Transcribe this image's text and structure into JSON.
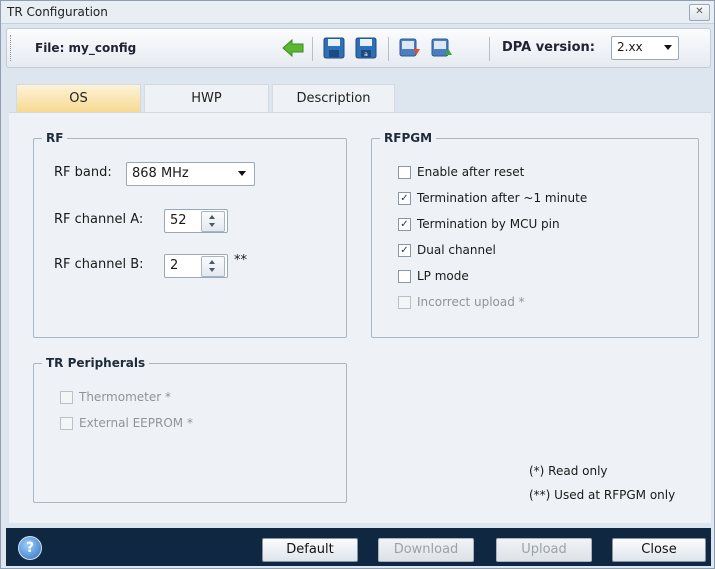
{
  "window": {
    "title": "TR Configuration",
    "close_glyph": "✕"
  },
  "toolbar": {
    "file_label": "File: my_config",
    "icons": [
      "back-arrow-icon",
      "save-icon",
      "save-as-icon",
      "download-icon",
      "upload-icon"
    ],
    "dpa_label": "DPA version:",
    "dpa_value": "2.xx"
  },
  "tabs": [
    {
      "label": "OS",
      "active": true
    },
    {
      "label": "HWP",
      "active": false
    },
    {
      "label": "Description",
      "active": false
    }
  ],
  "rf": {
    "legend": "RF",
    "band_label": "RF band:",
    "band_value": "868 MHz",
    "channel_a_label": "RF channel A:",
    "channel_a_value": "52",
    "channel_b_label": "RF channel B:",
    "channel_b_value": "2",
    "channel_b_note": "**"
  },
  "rfpgm": {
    "legend": "RFPGM",
    "items": [
      {
        "label": "Enable after reset",
        "checked": false,
        "disabled": false
      },
      {
        "label": "Termination after ~1 minute",
        "checked": true,
        "disabled": false
      },
      {
        "label": "Termination by MCU pin",
        "checked": true,
        "disabled": false
      },
      {
        "label": "Dual channel",
        "checked": true,
        "disabled": false
      },
      {
        "label": "LP mode",
        "checked": false,
        "disabled": false
      },
      {
        "label": "Incorrect upload *",
        "checked": false,
        "disabled": true
      }
    ]
  },
  "peripherals": {
    "legend": "TR Peripherals",
    "items": [
      {
        "label": "Thermometer *",
        "checked": false,
        "disabled": true
      },
      {
        "label": "External EEPROM *",
        "checked": false,
        "disabled": true
      }
    ]
  },
  "notes": {
    "read_only": "(*) Read only",
    "rfpgm_only": "(**) Used at RFPGM only"
  },
  "buttons": {
    "help": "?",
    "default": "Default",
    "download": "Download",
    "upload": "Upload",
    "close": "Close"
  },
  "colors": {
    "accent_tab": "#f7d88e",
    "bottom_bar": "#0f2740",
    "save_blue": "#2f6fb8",
    "arrow_green": "#5cb833"
  }
}
